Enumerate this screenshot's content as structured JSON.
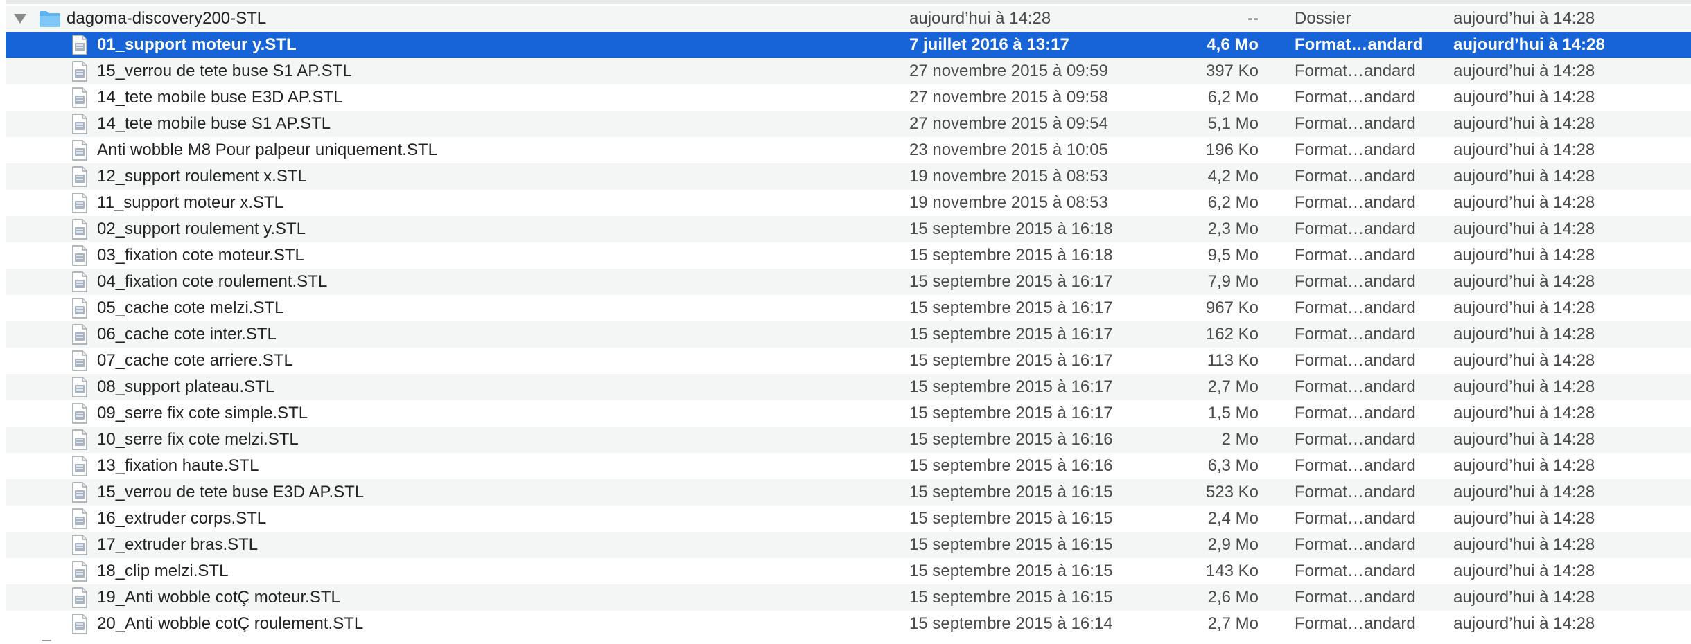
{
  "folder": {
    "name": "dagoma-discovery200-STL",
    "date_modified": "aujourd’hui à 14:28",
    "size": "--",
    "kind": "Dossier",
    "date_added": "aujourd’hui à 14:28",
    "expanded": true
  },
  "selected_index": 0,
  "colors": {
    "selection": "#1764d8",
    "stripe": "#f4f5f5",
    "folder": "#5eb4ef"
  },
  "files": [
    {
      "name": "01_support moteur y.STL",
      "date_modified": "7 juillet 2016 à 13:17",
      "size": "4,6 Mo",
      "kind": "Format…andard",
      "date_added": "aujourd’hui à 14:28"
    },
    {
      "name": "15_verrou de tete buse S1 AP.STL",
      "date_modified": "27 novembre 2015 à 09:59",
      "size": "397 Ko",
      "kind": "Format…andard",
      "date_added": "aujourd’hui à 14:28"
    },
    {
      "name": "14_tete mobile buse E3D AP.STL",
      "date_modified": "27 novembre 2015 à 09:58",
      "size": "6,2 Mo",
      "kind": "Format…andard",
      "date_added": "aujourd’hui à 14:28"
    },
    {
      "name": "14_tete mobile buse S1 AP.STL",
      "date_modified": "27 novembre 2015 à 09:54",
      "size": "5,1 Mo",
      "kind": "Format…andard",
      "date_added": "aujourd’hui à 14:28"
    },
    {
      "name": "Anti wobble M8 Pour palpeur uniquement.STL",
      "date_modified": "23 novembre 2015 à 10:05",
      "size": "196 Ko",
      "kind": "Format…andard",
      "date_added": "aujourd’hui à 14:28"
    },
    {
      "name": "12_support roulement x.STL",
      "date_modified": "19 novembre 2015 à 08:53",
      "size": "4,2 Mo",
      "kind": "Format…andard",
      "date_added": "aujourd’hui à 14:28"
    },
    {
      "name": "11_support moteur x.STL",
      "date_modified": "19 novembre 2015 à 08:53",
      "size": "6,2 Mo",
      "kind": "Format…andard",
      "date_added": "aujourd’hui à 14:28"
    },
    {
      "name": "02_support roulement y.STL",
      "date_modified": "15 septembre 2015 à 16:18",
      "size": "2,3 Mo",
      "kind": "Format…andard",
      "date_added": "aujourd’hui à 14:28"
    },
    {
      "name": "03_fixation cote moteur.STL",
      "date_modified": "15 septembre 2015 à 16:18",
      "size": "9,5 Mo",
      "kind": "Format…andard",
      "date_added": "aujourd’hui à 14:28"
    },
    {
      "name": "04_fixation cote roulement.STL",
      "date_modified": "15 septembre 2015 à 16:17",
      "size": "7,9 Mo",
      "kind": "Format…andard",
      "date_added": "aujourd’hui à 14:28"
    },
    {
      "name": "05_cache cote melzi.STL",
      "date_modified": "15 septembre 2015 à 16:17",
      "size": "967 Ko",
      "kind": "Format…andard",
      "date_added": "aujourd’hui à 14:28"
    },
    {
      "name": "06_cache cote inter.STL",
      "date_modified": "15 septembre 2015 à 16:17",
      "size": "162 Ko",
      "kind": "Format…andard",
      "date_added": "aujourd’hui à 14:28"
    },
    {
      "name": "07_cache cote arriere.STL",
      "date_modified": "15 septembre 2015 à 16:17",
      "size": "113 Ko",
      "kind": "Format…andard",
      "date_added": "aujourd’hui à 14:28"
    },
    {
      "name": "08_support plateau.STL",
      "date_modified": "15 septembre 2015 à 16:17",
      "size": "2,7 Mo",
      "kind": "Format…andard",
      "date_added": "aujourd’hui à 14:28"
    },
    {
      "name": "09_serre fix cote simple.STL",
      "date_modified": "15 septembre 2015 à 16:17",
      "size": "1,5 Mo",
      "kind": "Format…andard",
      "date_added": "aujourd’hui à 14:28"
    },
    {
      "name": "10_serre fix cote melzi.STL",
      "date_modified": "15 septembre 2015 à 16:16",
      "size": "2 Mo",
      "kind": "Format…andard",
      "date_added": "aujourd’hui à 14:28"
    },
    {
      "name": "13_fixation haute.STL",
      "date_modified": "15 septembre 2015 à 16:16",
      "size": "6,3 Mo",
      "kind": "Format…andard",
      "date_added": "aujourd’hui à 14:28"
    },
    {
      "name": "15_verrou de tete buse E3D AP.STL",
      "date_modified": "15 septembre 2015 à 16:15",
      "size": "523 Ko",
      "kind": "Format…andard",
      "date_added": "aujourd’hui à 14:28"
    },
    {
      "name": "16_extruder corps.STL",
      "date_modified": "15 septembre 2015 à 16:15",
      "size": "2,4 Mo",
      "kind": "Format…andard",
      "date_added": "aujourd’hui à 14:28"
    },
    {
      "name": "17_extruder bras.STL",
      "date_modified": "15 septembre 2015 à 16:15",
      "size": "2,9 Mo",
      "kind": "Format…andard",
      "date_added": "aujourd’hui à 14:28"
    },
    {
      "name": "18_clip melzi.STL",
      "date_modified": "15 septembre 2015 à 16:15",
      "size": "143 Ko",
      "kind": "Format…andard",
      "date_added": "aujourd’hui à 14:28"
    },
    {
      "name": "19_Anti wobble cotÇ moteur.STL",
      "date_modified": "15 septembre 2015 à 16:15",
      "size": "2,6 Mo",
      "kind": "Format…andard",
      "date_added": "aujourd’hui à 14:28"
    },
    {
      "name": "20_Anti wobble cotÇ roulement.STL",
      "date_modified": "15 septembre 2015 à 16:14",
      "size": "2,7 Mo",
      "kind": "Format…andard",
      "date_added": "aujourd’hui à 14:28"
    }
  ]
}
